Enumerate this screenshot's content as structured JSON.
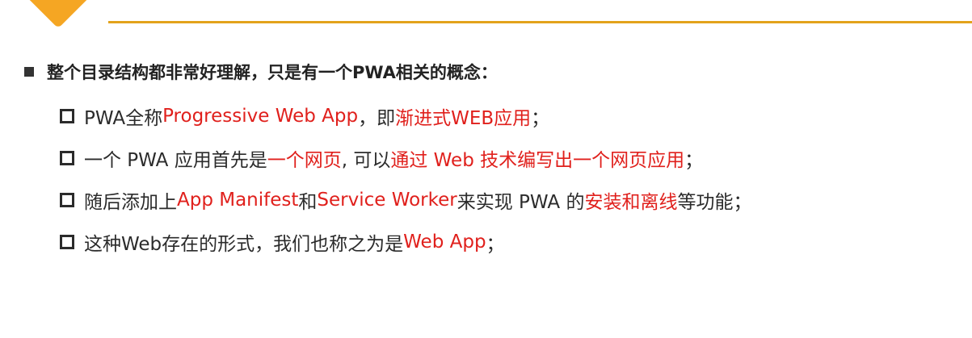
{
  "colors": {
    "accent": "#f5a623",
    "rule": "#e3a31c",
    "highlight": "#e0201c",
    "text": "#2b2b2b"
  },
  "heading": "整个目录结构都非常好理解，只是有一个PWA相关的概念：",
  "items": [
    {
      "parts": [
        "PWA全称",
        "Progressive Web App",
        "，即",
        "渐进式WEB应用",
        "；"
      ]
    },
    {
      "parts": [
        "一个 PWA 应用首先是",
        "一个网页",
        ", 可以",
        "通过 Web 技术编写出一个网页应用",
        "；"
      ]
    },
    {
      "parts": [
        "随后添加上 ",
        "App Manifest",
        " 和 ",
        "Service Worker",
        " 来实现 PWA 的",
        "安装和离线",
        "等功能；"
      ]
    },
    {
      "parts": [
        "这种Web存在的形式，我们也称之为是 ",
        "Web App",
        "；"
      ]
    }
  ]
}
